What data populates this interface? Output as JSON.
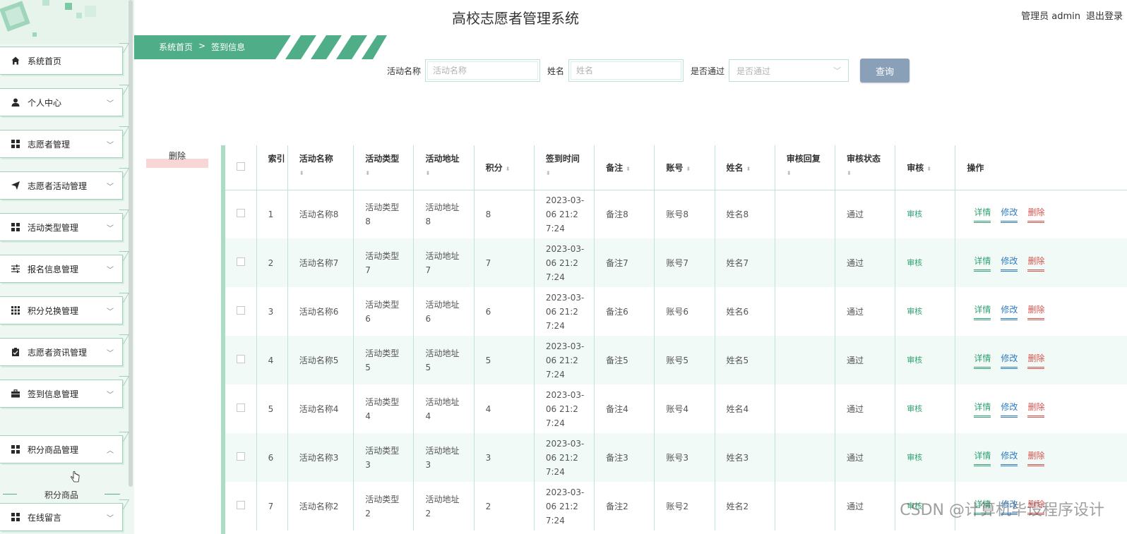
{
  "header": {
    "title": "高校志愿者管理系统",
    "user_label": "管理员 admin",
    "logout_label": "退出登录"
  },
  "sidebar": {
    "items": [
      {
        "label": "系统首页",
        "icon": "home-icon",
        "expandable": false
      },
      {
        "label": "个人中心",
        "icon": "user-icon",
        "expandable": true
      },
      {
        "label": "志愿者管理",
        "icon": "grid-icon",
        "expandable": true
      },
      {
        "label": "志愿者活动管理",
        "icon": "send-icon",
        "expandable": true
      },
      {
        "label": "活动类型管理",
        "icon": "grid-icon",
        "expandable": true
      },
      {
        "label": "报名信息管理",
        "icon": "sliders-icon",
        "expandable": true
      },
      {
        "label": "积分兑换管理",
        "icon": "apps-icon",
        "expandable": true
      },
      {
        "label": "志愿者资讯管理",
        "icon": "clipboard-icon",
        "expandable": true
      },
      {
        "label": "签到信息管理",
        "icon": "briefcase-icon",
        "expandable": true
      },
      {
        "label": "积分商品管理",
        "icon": "grid-icon",
        "expandable": true,
        "expanded": true
      },
      {
        "label": "在线留言",
        "icon": "grid-icon",
        "expandable": true
      }
    ],
    "submenu_item": "积分商品"
  },
  "breadcrumb": {
    "home": "系统首页",
    "separator": ">",
    "current": "签到信息"
  },
  "search": {
    "activity_label": "活动名称",
    "activity_placeholder": "活动名称",
    "name_label": "姓名",
    "name_placeholder": "姓名",
    "passed_label": "是否通过",
    "passed_placeholder": "是否通过",
    "button": "查询"
  },
  "batch_delete": "删除",
  "table": {
    "headers": [
      "索引",
      "活动名称",
      "活动类型",
      "活动地址",
      "积分",
      "签到时间",
      "备注",
      "账号",
      "姓名",
      "审核回复",
      "审核状态",
      "审核",
      "操作"
    ],
    "audit_link": "审核",
    "actions": {
      "detail": "详情",
      "edit": "修改",
      "delete": "删除"
    },
    "rows": [
      {
        "index": "1",
        "activity_name": "活动名称8",
        "activity_type": "活动类型8",
        "activity_address": "活动地址8",
        "points": "8",
        "checkin_time": "2023-03-06 21:27:24",
        "remark": "备注8",
        "account": "账号8",
        "name": "姓名8",
        "reply": "",
        "status": "通过"
      },
      {
        "index": "2",
        "activity_name": "活动名称7",
        "activity_type": "活动类型7",
        "activity_address": "活动地址7",
        "points": "7",
        "checkin_time": "2023-03-06 21:27:24",
        "remark": "备注7",
        "account": "账号7",
        "name": "姓名7",
        "reply": "",
        "status": "通过"
      },
      {
        "index": "3",
        "activity_name": "活动名称6",
        "activity_type": "活动类型6",
        "activity_address": "活动地址6",
        "points": "6",
        "checkin_time": "2023-03-06 21:27:24",
        "remark": "备注6",
        "account": "账号6",
        "name": "姓名6",
        "reply": "",
        "status": "通过"
      },
      {
        "index": "4",
        "activity_name": "活动名称5",
        "activity_type": "活动类型5",
        "activity_address": "活动地址5",
        "points": "5",
        "checkin_time": "2023-03-06 21:27:24",
        "remark": "备注5",
        "account": "账号5",
        "name": "姓名5",
        "reply": "",
        "status": "通过"
      },
      {
        "index": "5",
        "activity_name": "活动名称4",
        "activity_type": "活动类型4",
        "activity_address": "活动地址4",
        "points": "4",
        "checkin_time": "2023-03-06 21:27:24",
        "remark": "备注4",
        "account": "账号4",
        "name": "姓名4",
        "reply": "",
        "status": "通过"
      },
      {
        "index": "6",
        "activity_name": "活动名称3",
        "activity_type": "活动类型3",
        "activity_address": "活动地址3",
        "points": "3",
        "checkin_time": "2023-03-06 21:27:24",
        "remark": "备注3",
        "account": "账号3",
        "name": "姓名3",
        "reply": "",
        "status": "通过"
      },
      {
        "index": "7",
        "activity_name": "活动名称2",
        "activity_type": "活动类型2",
        "activity_address": "活动地址2",
        "points": "2",
        "checkin_time": "2023-03-06 21:27:24",
        "remark": "备注2",
        "account": "账号2",
        "name": "姓名2",
        "reply": "",
        "status": "通过"
      }
    ]
  },
  "watermark": "CSDN @计算机毕设程序设计",
  "colors": {
    "accent_green": "#4bb38a",
    "search_button": "#8aa0b8",
    "delete_red": "#d9534f",
    "edit_blue": "#2e7cc4"
  }
}
